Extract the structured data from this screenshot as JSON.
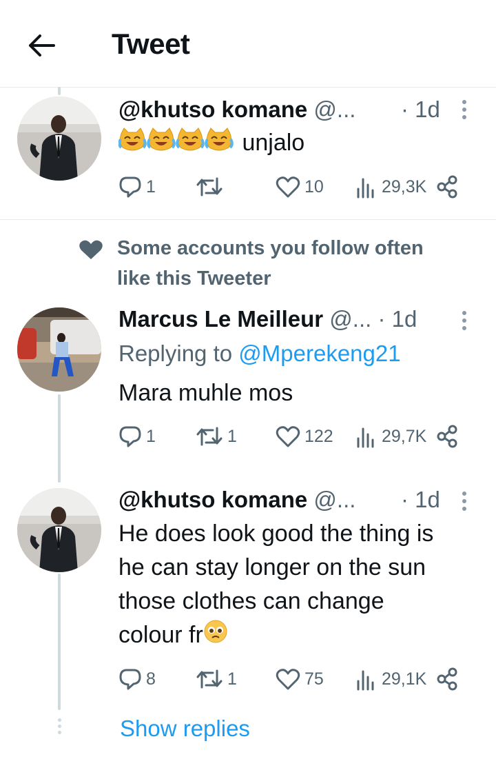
{
  "header": {
    "title": "Tweet"
  },
  "tweets": [
    {
      "name": "@khutso komane",
      "handle": "@...",
      "time": "· 1d",
      "text": "unjalo",
      "text_emoji": [
        "joy-cat-emoji",
        "joy-cat-emoji",
        "joy-cat-emoji",
        "joy-cat-emoji"
      ],
      "replies": "1",
      "retweets": "",
      "likes": "10",
      "views": "29,3K"
    },
    {
      "name": "Marcus Le Meilleur",
      "handle": "@...",
      "time": "· 1d",
      "replying_prefix": "Replying to",
      "replying_to": "@Mperekeng21",
      "text": "Mara muhle mos",
      "replies": "1",
      "retweets": "1",
      "likes": "122",
      "views": "29,7K"
    },
    {
      "name": "@khutso komane",
      "handle": "@...",
      "time": "· 1d",
      "text_lines": [
        "He does look good the thing is",
        "he can stay longer on the sun",
        "those clothes can change",
        "colour fr"
      ],
      "replies": "8",
      "retweets": "1",
      "likes": "75",
      "views": "29,1K"
    }
  ],
  "social_context": {
    "line1": "Some accounts you follow often",
    "line2": "like this Tweeter"
  },
  "show_replies": "Show replies",
  "colors": {
    "link": "#1d9bf0",
    "muted": "#536471",
    "divider": "#e7e9eb",
    "thread": "#cfd9de"
  },
  "icons": [
    "back-arrow-icon",
    "more-icon",
    "reply-icon",
    "retweet-icon",
    "like-icon",
    "views-icon",
    "share-icon",
    "heart-icon"
  ]
}
